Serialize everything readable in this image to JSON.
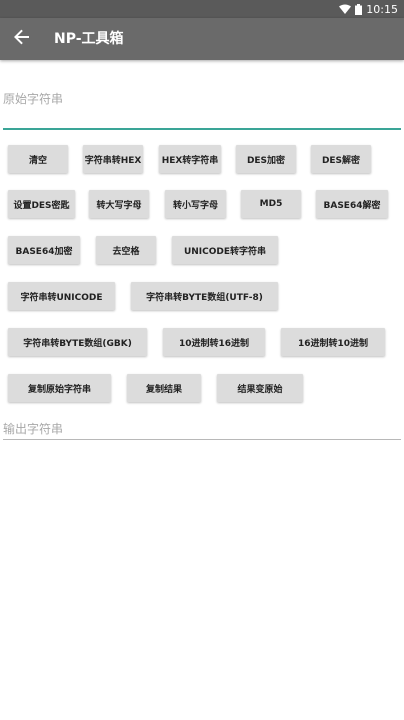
{
  "status": {
    "time": "10:15",
    "icons": [
      "wifi-icon",
      "battery-icon"
    ]
  },
  "app_bar": {
    "title": "NP-工具箱",
    "back_icon": "arrow-left-icon"
  },
  "input": {
    "placeholder": "原始字符串"
  },
  "output": {
    "placeholder": "输出字符串"
  },
  "buttons": {
    "clear": "清空",
    "str_to_hex": "字符串转HEX",
    "hex_to_str": "HEX转字符串",
    "des_encrypt": "DES加密",
    "des_decrypt": "DES解密",
    "set_des_key": "设置DES密匙",
    "to_upper": "转大写字母",
    "to_lower": "转小写字母",
    "md5": "MD5",
    "base64_decode": "BASE64解密",
    "base64_encode": "BASE64加密",
    "remove_spaces": "去空格",
    "unicode_to_str": "UNICODE转字符串",
    "str_to_unicode": "字符串转UNICODE",
    "str_to_bytes_utf8": "字符串转BYTE数组(UTF-8)",
    "str_to_bytes_gbk": "字符串转BYTE数组(GBK)",
    "dec_to_hex": "10进制转16进制",
    "hex_to_dec": "16进制转10进制",
    "copy_original": "复制原始字符串",
    "copy_result": "复制结果",
    "result_to_original": "结果变原始"
  },
  "colors": {
    "status_bar": "#5a5a5a",
    "app_bar": "#6a6a6a",
    "accent": "#3aa597",
    "button_bg": "#dcdcdc"
  }
}
